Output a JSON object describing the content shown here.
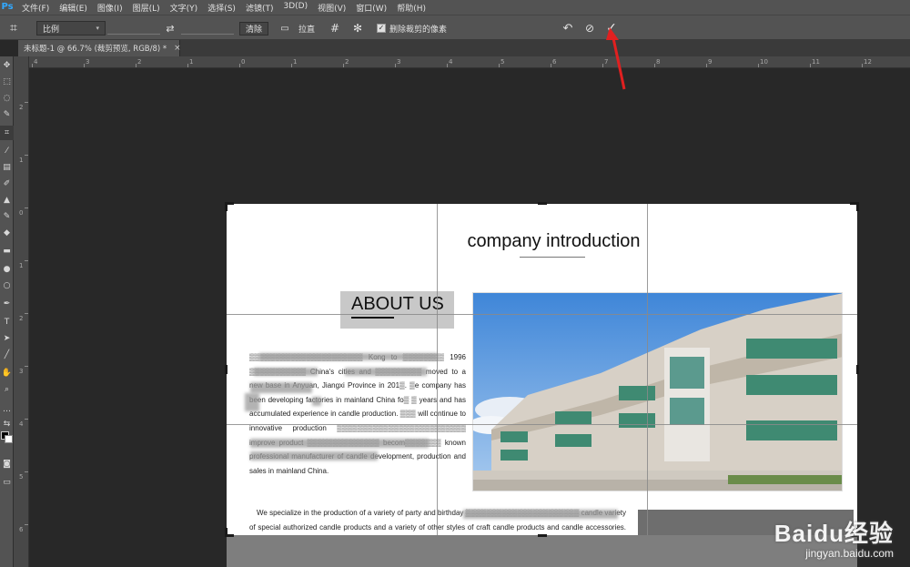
{
  "app": {
    "logo": "Ps",
    "menu": [
      "文件(F)",
      "编辑(E)",
      "图像(I)",
      "图层(L)",
      "文字(Y)",
      "选择(S)",
      "滤镜(T)",
      "3D(D)",
      "视图(V)",
      "窗口(W)",
      "帮助(H)"
    ]
  },
  "options": {
    "ratio_value": "比例",
    "width_value": "",
    "height_value": "",
    "clear_label": "清除",
    "straighten_label": "拉直",
    "delete_cropped_checked": true,
    "delete_cropped_label": "删除裁剪的像素"
  },
  "tab": {
    "label": "未标题-1 @ 66.7% (裁剪预览, RGB/8) *",
    "close": "×"
  },
  "ruler": {
    "top": [
      "4",
      "3",
      "2",
      "1",
      "0",
      "1",
      "2",
      "3",
      "4",
      "5",
      "6",
      "7",
      "8",
      "9",
      "10",
      "11",
      "12"
    ],
    "left": [
      "2",
      "1",
      "0",
      "1",
      "2",
      "3",
      "4",
      "5",
      "6"
    ]
  },
  "document": {
    "title": "company introduction",
    "about": "ABOUT US",
    "para1": "▒▒▒▒▒▒▒▒▒▒▒▒▒▒▒▒▒▒▒▒▒▒ Kong to ▒▒▒▒▒▒▒▒ 1996 ▒▒▒▒▒▒▒▒▒▒▒ China's cities and ▒▒▒▒▒▒▒▒▒ moved to a new base in Anyuan, Jiangxi Province in 201▒. ▒e company has been developing factories in mainland China fo▒ ▒ years and has accumulated experience in candle production. ▒▒▒ will continue to innovative production ▒▒▒▒▒▒▒▒▒▒▒▒▒▒▒▒▒▒▒▒▒▒▒▒▒ improve product ▒▒▒▒▒▒▒▒▒▒▒▒▒▒ becom▒▒▒▒▒▒▒ known professional manufacturer of candle development, production and sales in mainland China.",
    "para2": "We specialize in the production of a variety of party and birthday ▒▒▒▒▒▒▒▒▒▒▒▒▒▒▒▒▒▒▒▒▒▒ candle variety of special authorized candle products and a variety of other styles of craft candle products and candle accessories. The company has mature and exquisite production technology, rich experience in production management; has a complete scientific quality management system and a good operating mechanism. The product"
  },
  "watermark": {
    "logo": "Baidu经验",
    "url": "jingyan.baidu.com"
  },
  "colors": {
    "ui_dark": "#535353",
    "canvas_bg": "#282828",
    "arrow": "#e02020",
    "accent": "#31a8ff"
  }
}
